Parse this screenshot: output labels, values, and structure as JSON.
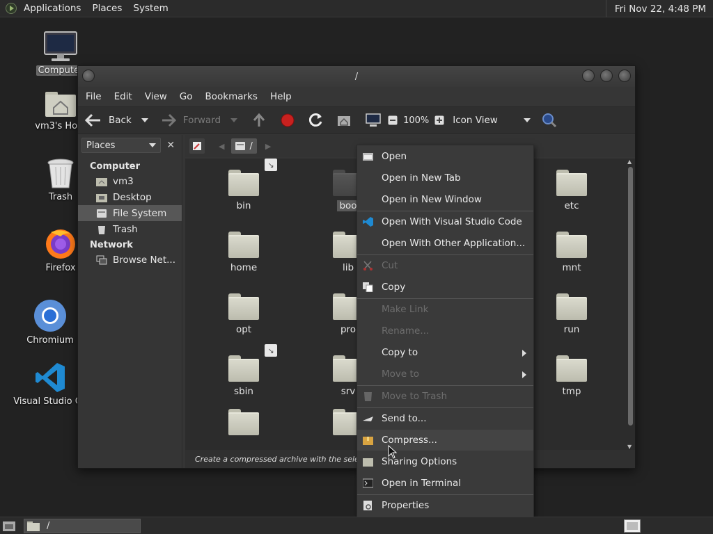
{
  "top_panel": {
    "menus": [
      "Applications",
      "Places",
      "System"
    ],
    "clock": "Fri Nov 22,  4:48 PM"
  },
  "desktop": {
    "icons": [
      {
        "label": "Computer",
        "icon": "monitor-icon"
      },
      {
        "label": "vm3's Hom",
        "icon": "home-folder-icon"
      },
      {
        "label": "Trash",
        "icon": "trash-icon"
      },
      {
        "label": "Firefox",
        "icon": "firefox-icon"
      },
      {
        "label": "Chromium",
        "icon": "chromium-icon"
      },
      {
        "label": "Visual Studio Co",
        "icon": "vscode-icon"
      }
    ]
  },
  "window": {
    "title": "/",
    "menu": [
      "File",
      "Edit",
      "View",
      "Go",
      "Bookmarks",
      "Help"
    ],
    "toolbar": {
      "back": "Back",
      "forward": "Forward",
      "zoom": "100%",
      "view_mode": "Icon View"
    },
    "sidebar": {
      "selector": "Places",
      "sections": [
        {
          "title": "Computer",
          "items": [
            "vm3",
            "Desktop",
            "File System",
            "Trash"
          ]
        },
        {
          "title": "Network",
          "items": [
            "Browse Net..."
          ]
        }
      ],
      "selected": "File System"
    },
    "location": {
      "path": "/"
    },
    "files": {
      "col1": [
        "bin",
        "home",
        "opt",
        "sbin"
      ],
      "col2": [
        "boo",
        "lib",
        "pro",
        "srv"
      ],
      "col3": [
        "etc",
        "mnt",
        "run",
        "tmp"
      ]
    },
    "status": "Create a compressed archive with the selected o"
  },
  "context_menu": {
    "items": [
      {
        "label": "Open",
        "enabled": true,
        "icon": "open-icon"
      },
      {
        "label": "Open in New Tab",
        "enabled": true
      },
      {
        "label": "Open in New Window",
        "enabled": true
      },
      {
        "label": "Open With Visual Studio Code",
        "enabled": true,
        "icon": "vscode-icon"
      },
      {
        "label": "Open With Other Application...",
        "enabled": true
      },
      {
        "label": "Cut",
        "enabled": false,
        "icon": "cut-icon"
      },
      {
        "label": "Copy",
        "enabled": true,
        "icon": "copy-icon"
      },
      {
        "label": "Make Link",
        "enabled": false
      },
      {
        "label": "Rename...",
        "enabled": false
      },
      {
        "label": "Copy to",
        "enabled": true,
        "submenu": true
      },
      {
        "label": "Move to",
        "enabled": false,
        "submenu": true
      },
      {
        "label": "Move to Trash",
        "enabled": false,
        "icon": "trash-icon"
      },
      {
        "label": "Send to...",
        "enabled": true,
        "icon": "send-icon"
      },
      {
        "label": "Compress...",
        "enabled": true,
        "icon": "archive-icon"
      },
      {
        "label": "Sharing Options",
        "enabled": true,
        "icon": "share-folder-icon"
      },
      {
        "label": "Open in Terminal",
        "enabled": true,
        "icon": "terminal-icon"
      },
      {
        "label": "Properties",
        "enabled": true,
        "icon": "properties-icon"
      }
    ]
  },
  "bottom_panel": {
    "task": "/"
  }
}
